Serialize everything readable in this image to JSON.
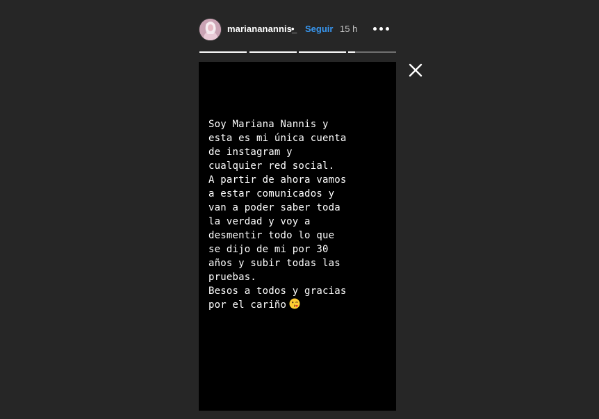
{
  "header": {
    "username": "mariananannis_",
    "separator": "•",
    "follow_label": "Seguir",
    "timestamp": "15 h",
    "avatar_icon": "profile-avatar",
    "more_icon": "more-options-icon"
  },
  "progress": {
    "segments": [
      {
        "filled": 1.0
      },
      {
        "filled": 1.0
      },
      {
        "filled": 1.0
      },
      {
        "filled": 0.15
      }
    ]
  },
  "close_icon": "close-icon",
  "story": {
    "text_lines": [
      "Soy Mariana Nannis y",
      "esta es mi única cuenta",
      "de instagram y",
      "cualquier red social.",
      "A partir de ahora vamos",
      "a estar comunicados y",
      "van a poder saber toda",
      "la verdad y voy a",
      "desmentir todo lo que",
      "se dijo de mi por 30",
      "años y subir todas las",
      "pruebas.",
      "Besos a todos y gracias",
      "por el cariño"
    ],
    "emoji_icon": "kissing-face-wink-emoji"
  },
  "colors": {
    "background": "#262626",
    "story_bg": "#000000",
    "follow": "#3897f0",
    "text": "#ffffff"
  }
}
